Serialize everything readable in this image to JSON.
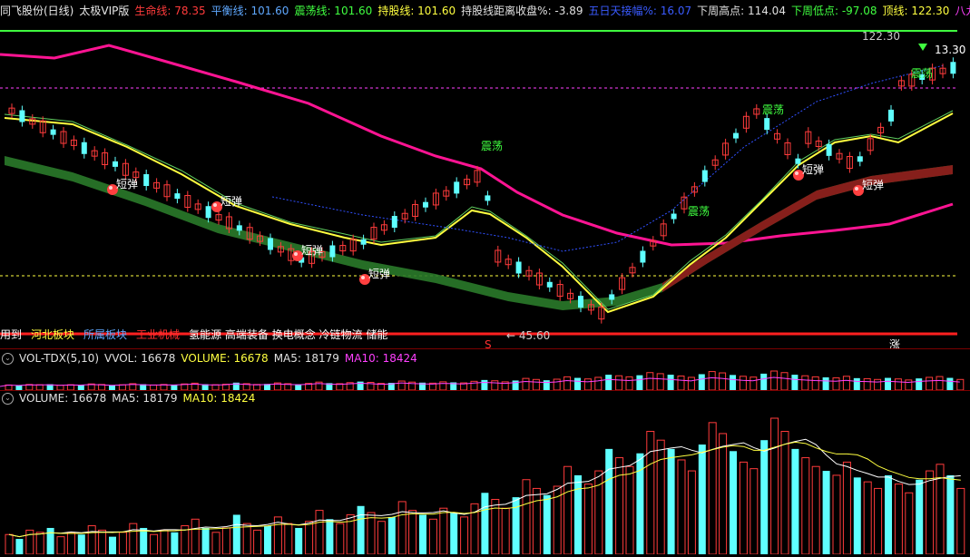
{
  "header": {
    "stock_title": "同飞股份(日线)",
    "version": "太极VIP版",
    "indicators": [
      {
        "label": "生命线:",
        "value": "78.35",
        "color": "#ff3b3b"
      },
      {
        "label": "平衡线:",
        "value": "101.60",
        "color": "#5fa8ff"
      },
      {
        "label": "震荡线:",
        "value": "101.60",
        "color": "#40ff40"
      },
      {
        "label": "持股线:",
        "value": "101.60",
        "color": "#ffff40"
      },
      {
        "label": "持股线距离收盘%:",
        "value": "-3.89",
        "color": "#e0e0e0"
      },
      {
        "label": "五日天接幅%:",
        "value": "16.07",
        "color": "#3a5bff"
      },
      {
        "label": "下周高点:",
        "value": "114.04",
        "color": "#e0e0e0"
      },
      {
        "label": "下周低点:",
        "value": "-97.08",
        "color": "#40ff40"
      },
      {
        "label": "顶线:",
        "value": "122.30",
        "color": "#ffff40"
      },
      {
        "label": "八九线:",
        "value": "◇",
        "color": "#ff40ff"
      }
    ]
  },
  "main_chart": {
    "high_label": "122.30",
    "low_label": "45.60",
    "right_label": "13.30",
    "annotations": {
      "zhendang": "震荡",
      "duantan": "短弹",
      "s_mark": "S",
      "zhang_mark": "涨"
    }
  },
  "sectors": [
    {
      "text": "用到",
      "color": "#ffffff"
    },
    {
      "text": "河北板块",
      "color": "#ffff40"
    },
    {
      "text": "所属板块",
      "color": "#5fa8ff"
    },
    {
      "text": "工业机械",
      "color": "#ff3030"
    },
    {
      "text": "氢能源 高端装备 换电概念 冷链物流 储能",
      "color": "#ffffff"
    }
  ],
  "vol_tdx": {
    "title": "VOL-TDX(5,10)",
    "items": [
      {
        "label": "VVOL:",
        "value": "16678",
        "color": "#e0e0e0"
      },
      {
        "label": "VOLUME:",
        "value": "16678",
        "color": "#ffff40"
      },
      {
        "label": "MA5:",
        "value": "18179",
        "color": "#e0e0e0"
      },
      {
        "label": "MA10:",
        "value": "18424",
        "color": "#ff40ff"
      }
    ]
  },
  "volume": {
    "items": [
      {
        "label": "VOLUME:",
        "value": "16678",
        "color": "#e0e0e0"
      },
      {
        "label": "MA5:",
        "value": "18179",
        "color": "#e0e0e0"
      },
      {
        "label": "MA10:",
        "value": "18424",
        "color": "#ffff40"
      }
    ]
  },
  "colors": {
    "up": "#ff3b3b",
    "down": "#5fffff",
    "lifeline": "#ff1493",
    "balance": "#3050ff",
    "hold": "#ffff40",
    "band": "#8b1a1a",
    "band_green": "#1a6b1a"
  },
  "chart_data": {
    "type": "candlestick",
    "volume_values": [
      9,
      7,
      11,
      10,
      12,
      8,
      10,
      9,
      13,
      11,
      8,
      10,
      14,
      12,
      9,
      11,
      10,
      13,
      16,
      12,
      10,
      12,
      18,
      14,
      11,
      13,
      17,
      14,
      12,
      15,
      20,
      16,
      14,
      18,
      22,
      19,
      15,
      17,
      24,
      20,
      18,
      16,
      21,
      19,
      17,
      23,
      28,
      25,
      21,
      26,
      34,
      30,
      27,
      31,
      40,
      36,
      32,
      38,
      48,
      44,
      40,
      46,
      56,
      52,
      48,
      43,
      38,
      50,
      60,
      55,
      47,
      42,
      39,
      52,
      62,
      56,
      48,
      44,
      40,
      38,
      36,
      42,
      35,
      33,
      30,
      36,
      32,
      28,
      34,
      38,
      41,
      36,
      30
    ]
  }
}
